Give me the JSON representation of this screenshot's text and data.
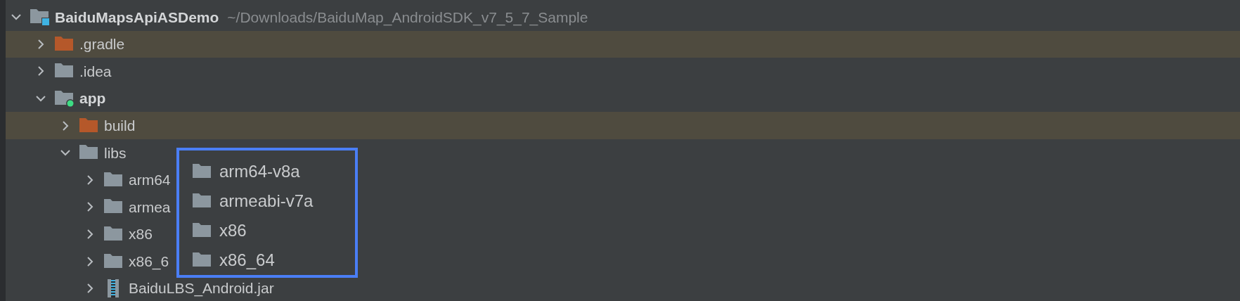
{
  "project_tree": {
    "name": "BaiduMapsApiASDemo",
    "path": "~/Downloads/BaiduMap_AndroidSDK_v7_5_7_Sample",
    "kind": "module",
    "expanded": true,
    "children": [
      {
        "name": ".gradle",
        "kind": "folder",
        "excluded": true,
        "expanded": false
      },
      {
        "name": ".idea",
        "kind": "folder",
        "excluded": false,
        "expanded": false
      },
      {
        "name": "app",
        "kind": "app-module",
        "excluded": false,
        "expanded": true,
        "children": [
          {
            "name": "build",
            "kind": "folder",
            "excluded": true,
            "expanded": false
          },
          {
            "name": "libs",
            "kind": "folder",
            "excluded": false,
            "expanded": true,
            "children": [
              {
                "name": "arm64",
                "kind": "folder",
                "excluded": false,
                "expanded": false
              },
              {
                "name": "armea",
                "kind": "folder",
                "excluded": false,
                "expanded": false
              },
              {
                "name": "x86",
                "kind": "folder",
                "excluded": false,
                "expanded": false
              },
              {
                "name": "x86_6",
                "kind": "folder",
                "excluded": false,
                "expanded": false
              },
              {
                "name": "BaiduLBS_Android.jar",
                "kind": "jar",
                "excluded": false,
                "expanded": false
              }
            ]
          }
        ]
      }
    ]
  },
  "callout": {
    "items": [
      {
        "name": "arm64-v8a",
        "kind": "folder"
      },
      {
        "name": "armeabi-v7a",
        "kind": "folder"
      },
      {
        "name": "x86",
        "kind": "folder"
      },
      {
        "name": "x86_64",
        "kind": "folder"
      }
    ]
  }
}
